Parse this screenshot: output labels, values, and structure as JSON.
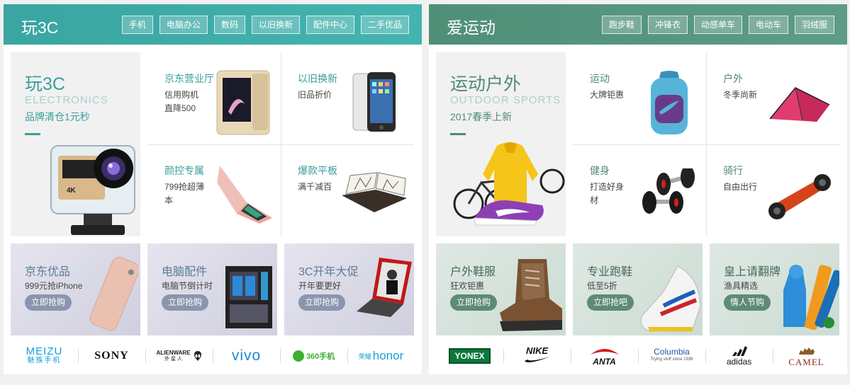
{
  "left": {
    "title": "玩3C",
    "tags": [
      "手机",
      "电脑办公",
      "数码",
      "以旧换新",
      "配件中心",
      "二手优品"
    ],
    "hero": {
      "title": "玩3C",
      "en": "ELECTRONICS",
      "sub": "品牌清仓1元秒"
    },
    "cells": [
      {
        "title": "京东营业厅",
        "sub": "信用购机 直降500"
      },
      {
        "title": "以旧换新",
        "sub": "旧品折价"
      },
      {
        "title": "颜控专属",
        "sub": "799抢超薄本"
      },
      {
        "title": "爆款平板",
        "sub": "满千减百"
      }
    ],
    "promos": [
      {
        "title": "京东优品",
        "sub": "999元抢iPhone",
        "btn": "立即抢购"
      },
      {
        "title": "电脑配件",
        "sub": "电脑节倒计时",
        "btn": "立即抢购"
      },
      {
        "title": "3C开年大促",
        "sub": "开年要更好",
        "btn": "立即抢购"
      }
    ],
    "brands": [
      {
        "name": "MEIZU",
        "sub": "魅族手机"
      },
      {
        "name": "SONY"
      },
      {
        "name": "ALIENWARE",
        "sub": "外 星 人"
      },
      {
        "name": "vivo"
      },
      {
        "name": "360手机"
      },
      {
        "name": "honor",
        "sub": "荣耀"
      }
    ]
  },
  "right": {
    "title": "爱运动",
    "tags": [
      "跑步鞋",
      "冲锋衣",
      "动感单车",
      "电动车",
      "羽绒服"
    ],
    "hero": {
      "title": "运动户外",
      "en": "OUTDOOR SPORTS",
      "sub": "2017春季上新"
    },
    "cells": [
      {
        "title": "运动",
        "sub": "大牌钜惠"
      },
      {
        "title": "户外",
        "sub": "冬季尚新"
      },
      {
        "title": "健身",
        "sub": "打造好身材"
      },
      {
        "title": "骑行",
        "sub": "自由出行"
      }
    ],
    "promos": [
      {
        "title": "户外鞋服",
        "sub": "狂欢钜惠",
        "btn": "立即抢购"
      },
      {
        "title": "专业跑鞋",
        "sub": "低至5折",
        "btn": "立即抢吧"
      },
      {
        "title": "皇上请翻牌",
        "sub": "渔具精选",
        "btn": "情人节购"
      }
    ],
    "brands": [
      {
        "name": "YONEX"
      },
      {
        "name": "NIKE"
      },
      {
        "name": "ANTA"
      },
      {
        "name": "Columbia",
        "sub": "Trying stuff since 1938"
      },
      {
        "name": "adidas"
      },
      {
        "name": "CAMEL"
      }
    ]
  }
}
